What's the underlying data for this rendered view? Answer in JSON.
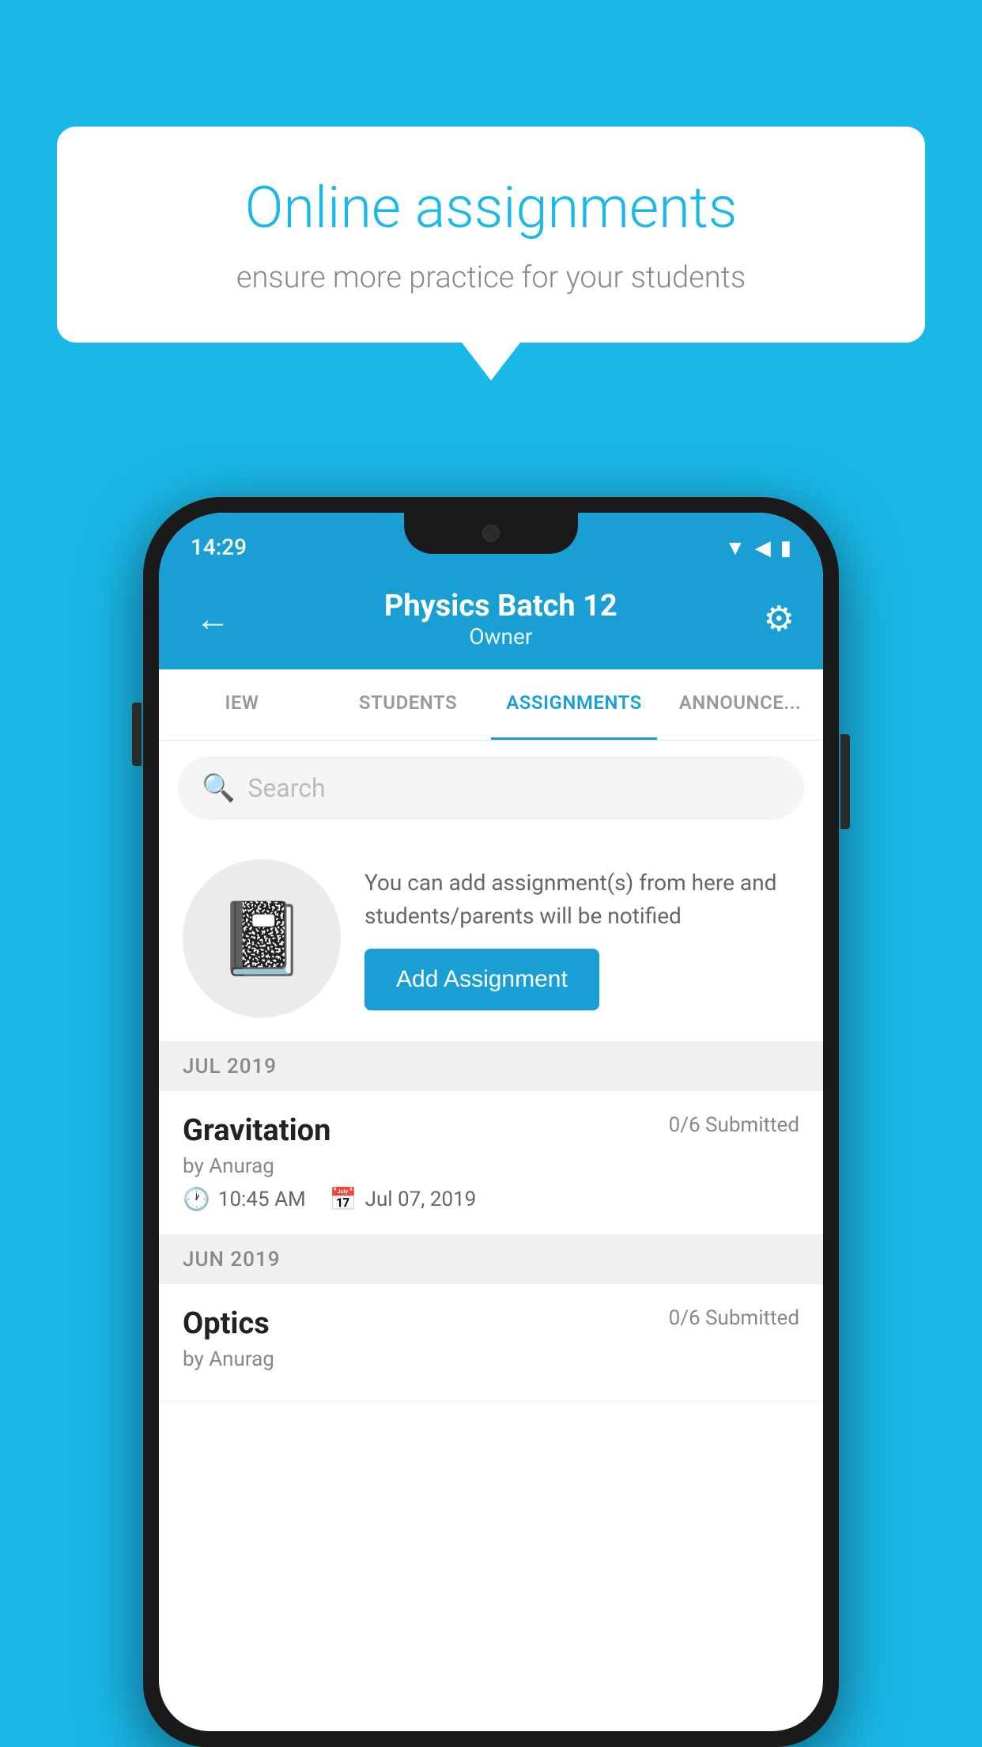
{
  "background_color": "#1ab8e8",
  "speech_bubble": {
    "title": "Online assignments",
    "subtitle": "ensure more practice for your students"
  },
  "status_bar": {
    "time": "14:29",
    "wifi": "▲",
    "signal": "◀",
    "battery": "▮"
  },
  "app_bar": {
    "title": "Physics Batch 12",
    "subtitle": "Owner",
    "back_label": "←",
    "settings_label": "⚙"
  },
  "tabs": [
    {
      "id": "iew",
      "label": "IEW",
      "active": false
    },
    {
      "id": "students",
      "label": "STUDENTS",
      "active": false
    },
    {
      "id": "assignments",
      "label": "ASSIGNMENTS",
      "active": true
    },
    {
      "id": "announcements",
      "label": "ANNOUNCEMENTS",
      "active": false
    }
  ],
  "search": {
    "placeholder": "Search"
  },
  "info_section": {
    "description": "You can add assignment(s) from here and students/parents will be notified",
    "add_button_label": "Add Assignment"
  },
  "assignments": [
    {
      "month_header": "JUL 2019",
      "items": [
        {
          "name": "Gravitation",
          "submitted": "0/6 Submitted",
          "by": "by Anurag",
          "time": "10:45 AM",
          "date": "Jul 07, 2019"
        }
      ]
    },
    {
      "month_header": "JUN 2019",
      "items": [
        {
          "name": "Optics",
          "submitted": "0/6 Submitted",
          "by": "by Anurag",
          "time": "",
          "date": ""
        }
      ]
    }
  ]
}
